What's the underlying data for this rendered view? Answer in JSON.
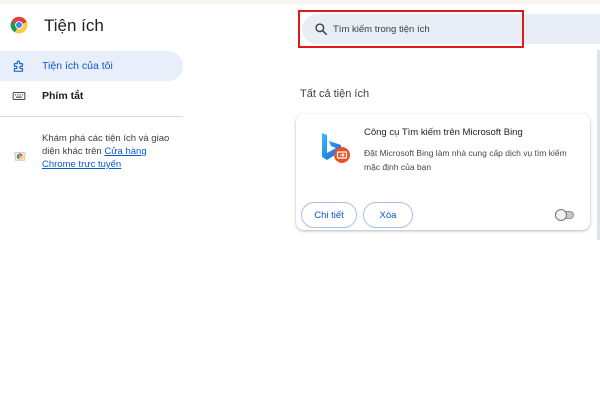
{
  "header": {
    "title": "Tiện ích",
    "logo_icon": "chrome-logo-icon"
  },
  "search": {
    "icon": "search-icon",
    "placeholder": "Tìm kiếm trong tiện ích",
    "value": "",
    "highlight_color": "#e0191b"
  },
  "sidebar": {
    "items": [
      {
        "label": "Tiện ích của tôi",
        "icon": "puzzle-icon",
        "active": true
      },
      {
        "label": "Phím tắt",
        "icon": "keyboard-icon",
        "active": false
      }
    ],
    "discover": {
      "icon": "chrome-web-store-icon",
      "text": "Khám phá các tiện ích và giao diện khác trên ",
      "link_text": "Cửa hàng Chrome trực tuyến"
    }
  },
  "main": {
    "section_title": "Tất cả tiện ích",
    "extensions": [
      {
        "name": "Công cụ Tìm kiếm trên Microsoft Bing",
        "description": "Đặt Microsoft Bing làm nhà cung cấp dịch vụ tìm kiếm mặc định của bạn",
        "icon": "bing-icon",
        "details_label": "Chi tiết",
        "remove_label": "Xóa",
        "enabled": false
      }
    ]
  },
  "colors": {
    "accent": "#0b57d0",
    "active_bg": "#e8eefa",
    "search_bg": "#e9eef6"
  }
}
